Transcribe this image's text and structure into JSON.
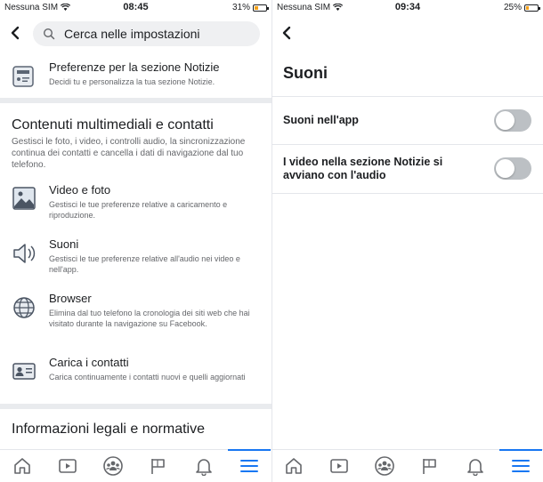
{
  "left": {
    "status": {
      "carrier": "Nessuna SIM",
      "time": "08:45",
      "battery": "31%",
      "battery_level": 0.31
    },
    "search": {
      "placeholder": "Cerca nelle impostazioni"
    },
    "news_pref": {
      "title": "Preferenze per la sezione Notizie",
      "desc": "Decidi tu e personalizza la tua sezione Notizie."
    },
    "media_section": {
      "title": "Contenuti multimediali e contatti",
      "desc": "Gestisci le foto, i video, i controlli audio, la sincronizzazione continua dei contatti e cancella i dati di navigazione dal tuo telefono."
    },
    "items": [
      {
        "title": "Video e foto",
        "desc": "Gestisci le tue preferenze relative a caricamento e riproduzione.",
        "icon": "photo-video-icon"
      },
      {
        "title": "Suoni",
        "desc": "Gestisci le tue preferenze relative all'audio nei video e nell'app.",
        "icon": "speaker-icon"
      },
      {
        "title": "Browser",
        "desc": "Elimina dal tuo telefono la cronologia dei siti web che hai visitato durante la navigazione su Facebook.",
        "icon": "globe-icon"
      },
      {
        "title": "Carica i contatti",
        "desc": "Carica continuamente i contatti nuovi e quelli aggiornati",
        "icon": "contact-card-icon"
      }
    ],
    "legal_section": {
      "title": "Informazioni legali e normative"
    }
  },
  "right": {
    "status": {
      "carrier": "Nessuna SIM",
      "time": "09:34",
      "battery": "25%",
      "battery_level": 0.25
    },
    "title": "Suoni",
    "settings": [
      {
        "label": "Suoni nell'app",
        "enabled": false
      },
      {
        "label": "I video nella sezione Notizie si avviano con l'audio",
        "enabled": false
      }
    ]
  },
  "tabbar": {
    "tabs": [
      "home-icon",
      "watch-icon",
      "groups-icon",
      "pages-flag-icon",
      "notifications-bell-icon",
      "menu-icon"
    ],
    "active": "menu-icon",
    "accent": "#1877f2"
  }
}
